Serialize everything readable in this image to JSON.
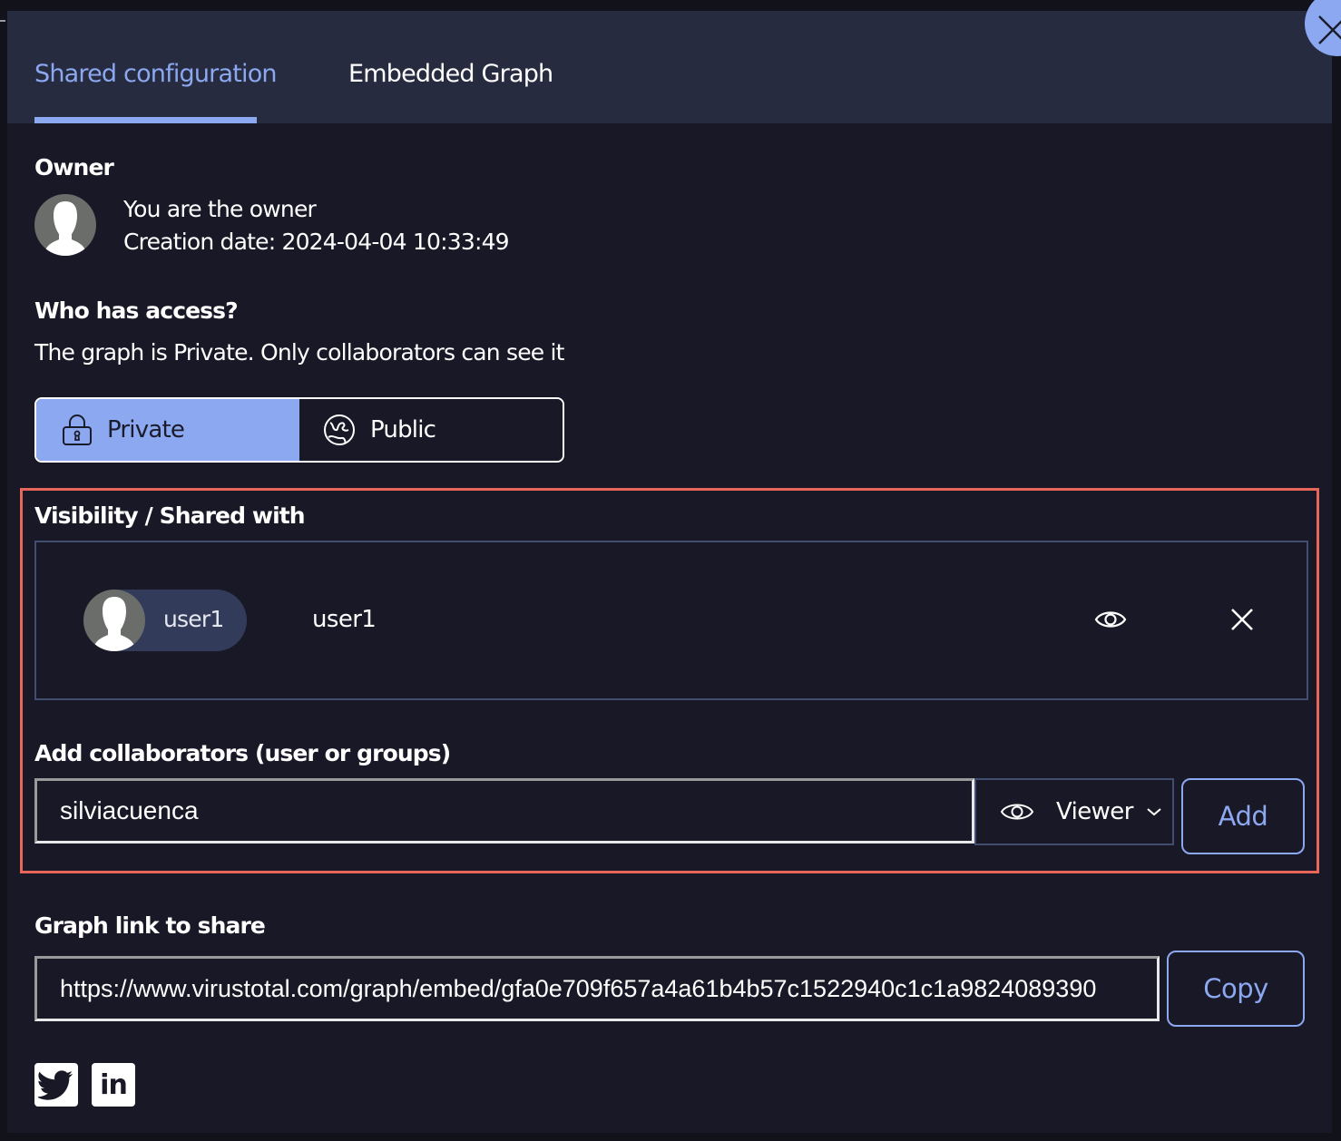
{
  "tabs": [
    {
      "label": "Shared configuration",
      "active": true
    },
    {
      "label": "Embedded Graph",
      "active": false
    }
  ],
  "owner": {
    "heading": "Owner",
    "line1": "You are the owner",
    "line2": "Creation date: 2024-04-04 10:33:49"
  },
  "access": {
    "heading": "Who has access?",
    "description": "The graph is Private. Only collaborators can see it",
    "options": [
      {
        "label": "Private",
        "icon": "lock-icon",
        "selected": true
      },
      {
        "label": "Public",
        "icon": "globe-icon",
        "selected": false
      }
    ]
  },
  "visibility": {
    "heading": "Visibility / Shared with",
    "shared": [
      {
        "chip_label": "user1",
        "name": "user1",
        "permission_icon": "eye-icon",
        "remove_icon": "close-icon"
      }
    ]
  },
  "collaborators": {
    "heading": "Add collaborators (user or groups)",
    "input_value": "silviacuenca",
    "role": "Viewer",
    "add_label": "Add"
  },
  "link": {
    "heading": "Graph link to share",
    "url": "https://www.virustotal.com/graph/embed/gfa0e709f657a4a61b4b57c1522940c1c1a9824089390",
    "copy_label": "Copy"
  },
  "social": [
    {
      "name": "twitter",
      "icon": "twitter-icon"
    },
    {
      "name": "linkedin",
      "icon": "linkedin-icon",
      "glyph": "in"
    }
  ],
  "colors": {
    "accent": "#8ca8f0",
    "highlight": "#e8675a",
    "background": "#191826",
    "tabbar": "#262b40"
  }
}
